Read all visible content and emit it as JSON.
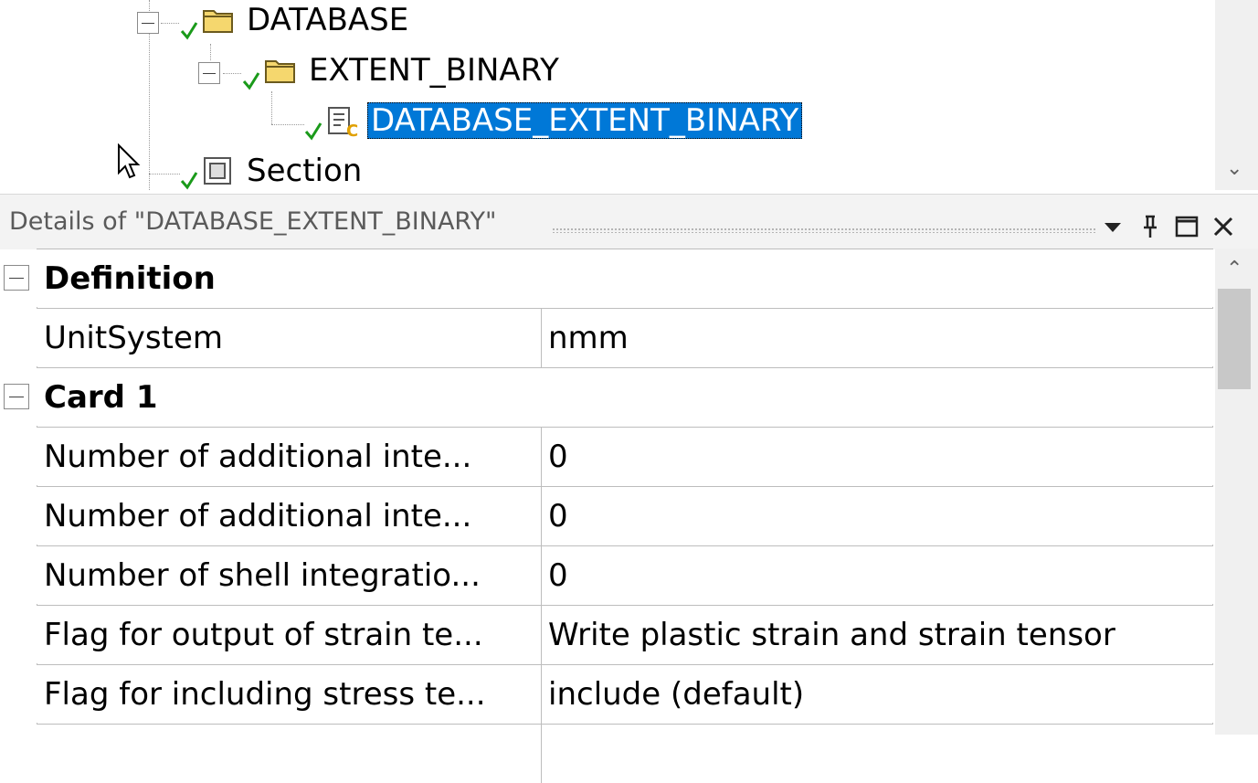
{
  "tree": {
    "nodes": [
      {
        "label": "DATABASE",
        "icon": "folder-icon",
        "status": "check-icon"
      },
      {
        "label": "EXTENT_BINARY",
        "icon": "folder-icon",
        "status": "check-icon"
      },
      {
        "label": "DATABASE_EXTENT_BINARY",
        "icon": "keyword-card-icon",
        "status": "check-icon",
        "selected": true
      },
      {
        "label": "Section",
        "icon": "section-icon",
        "status": "check-icon"
      }
    ],
    "scroll_down_glyph": "⌄"
  },
  "details": {
    "title": "Details of \"DATABASE_EXTENT_BINARY\"",
    "buttons": [
      "dropdown-icon",
      "pin-icon",
      "maximize-icon",
      "close-icon"
    ],
    "categories": [
      {
        "name": "Definition",
        "properties": [
          {
            "name": "UnitSystem",
            "value": "nmm"
          }
        ]
      },
      {
        "name": "Card 1",
        "properties": [
          {
            "name": "Number of additional inte...",
            "value": "0"
          },
          {
            "name": "Number of additional inte...",
            "value": "0"
          },
          {
            "name": "Number of shell integratio...",
            "value": "0"
          },
          {
            "name": "Flag for output of strain te...",
            "value": "Write plastic strain and strain tensor"
          },
          {
            "name": "Flag for including stress te...",
            "value": "include (default)"
          }
        ]
      }
    ],
    "scroll_up_glyph": "⌃"
  },
  "colors": {
    "selection": "#0078d7",
    "check": "#1a9a1a",
    "folder": "#f5d76e"
  }
}
